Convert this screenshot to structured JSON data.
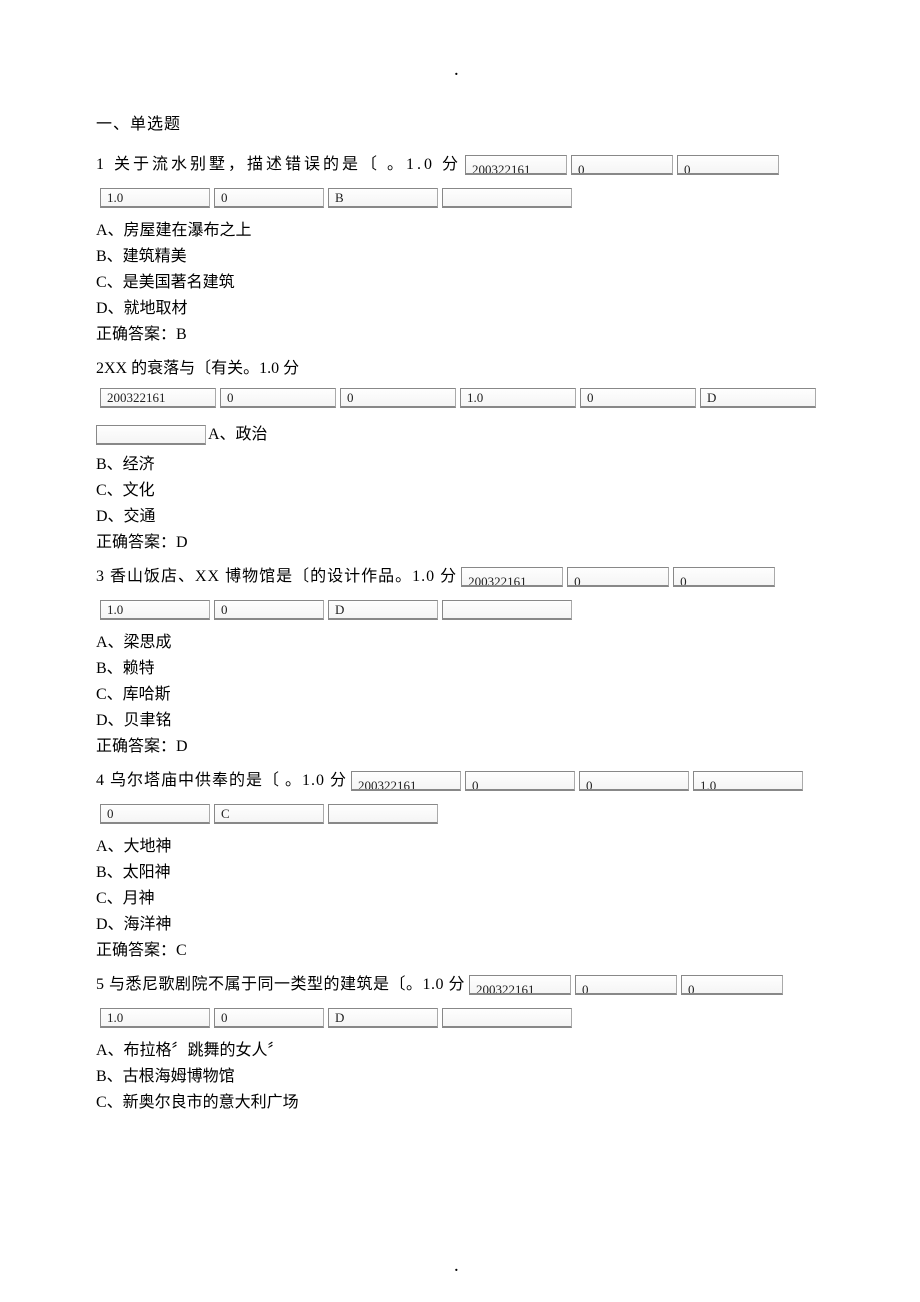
{
  "decor": {
    "dot_top": "．",
    "dot_bottom": "．"
  },
  "heading": "一、单选题",
  "correct_label": "正确答案：",
  "q1": {
    "text": "1 关于流水别墅，描述错误的是〔 。1.0 分",
    "cells_a": [
      "200322161",
      "0",
      "0"
    ],
    "cells_b": [
      "1.0",
      "0",
      "B",
      ""
    ],
    "opts": [
      "A、房屋建在瀑布之上",
      "B、建筑精美",
      "C、是美国著名建筑",
      "D、就地取材"
    ],
    "ans": "B"
  },
  "q2": {
    "text": "2XX 的衰落与〔有关。1.0 分",
    "cells_a": [
      "200322161",
      "0",
      "0",
      "1.0",
      "0",
      "D"
    ],
    "cells_b": [
      ""
    ],
    "opt_first_inline": "A、政治",
    "opts": [
      "B、经济",
      "C、文化",
      "D、交通"
    ],
    "ans": "D"
  },
  "q3": {
    "text": "3 香山饭店、XX 博物馆是〔的设计作品。1.0 分",
    "cells_a": [
      "200322161",
      "0",
      "0"
    ],
    "cells_b": [
      "1.0",
      "0",
      "D",
      ""
    ],
    "opts": [
      "A、梁思成",
      "B、赖特",
      "C、库哈斯",
      "D、贝聿铭"
    ],
    "ans": "D"
  },
  "q4": {
    "text": "4 乌尔塔庙中供奉的是〔 。1.0 分",
    "cells_a": [
      "200322161",
      "0",
      "0",
      "1.0"
    ],
    "cells_b": [
      "0",
      "C",
      ""
    ],
    "opts": [
      "A、大地神",
      "B、太阳神",
      "C、月神",
      "D、海洋神"
    ],
    "ans": "C"
  },
  "q5": {
    "text": "5 与悉尼歌剧院不属于同一类型的建筑是〔。1.0 分",
    "cells_a": [
      "200322161",
      "0",
      "0"
    ],
    "cells_b": [
      "1.0",
      "0",
      "D",
      ""
    ],
    "opts": [
      "A、布拉格〞跳舞的女人〞",
      "B、古根海姆博物馆",
      "C、新奥尔良市的意大利广场"
    ]
  }
}
